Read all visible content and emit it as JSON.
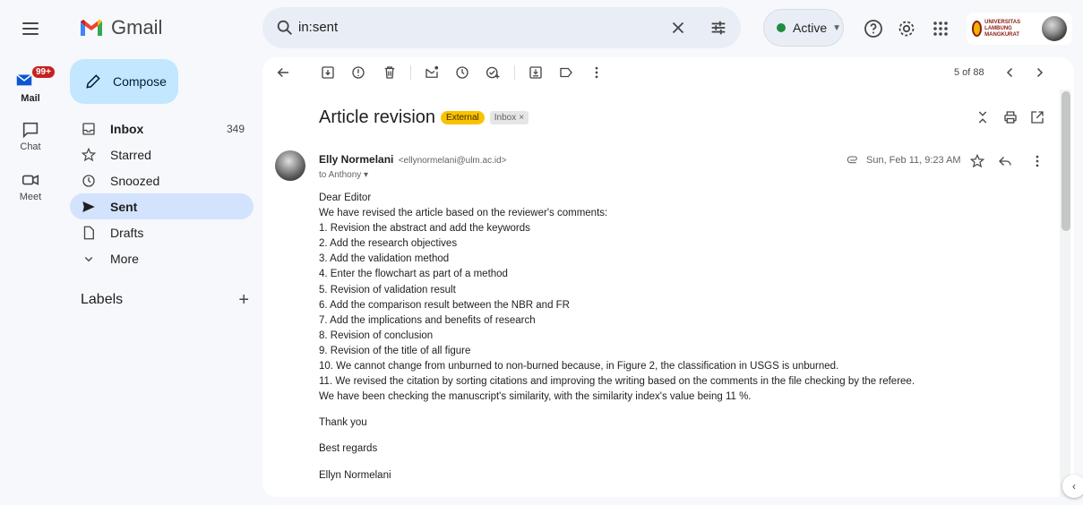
{
  "app": {
    "name": "Gmail"
  },
  "search": {
    "query": "in:sent"
  },
  "status": {
    "label": "Active",
    "color": "#1e8e3e"
  },
  "account": {
    "institution": "UNIVERSITAS LAMBUNG MANGKURAT"
  },
  "rail": {
    "mail": {
      "label": "Mail",
      "badge": "99+"
    },
    "chat": {
      "label": "Chat"
    },
    "meet": {
      "label": "Meet"
    }
  },
  "compose": {
    "label": "Compose"
  },
  "nav": {
    "items": [
      {
        "label": "Inbox",
        "count": "349",
        "icon": "inbox-icon"
      },
      {
        "label": "Starred",
        "icon": "star-icon"
      },
      {
        "label": "Snoozed",
        "icon": "clock-icon"
      },
      {
        "label": "Sent",
        "icon": "send-icon"
      },
      {
        "label": "Drafts",
        "icon": "draft-icon"
      },
      {
        "label": "More",
        "icon": "chevron-down-icon"
      }
    ],
    "labels_title": "Labels"
  },
  "toolbar": {
    "pager": "5 of 88"
  },
  "message": {
    "subject": "Article revision",
    "tags": {
      "external": "External",
      "inbox": "Inbox",
      "remove": "×"
    },
    "sender_name": "Elly Normelani",
    "sender_email": "<ellynormelani@ulm.ac.id>",
    "to": "to Anthony ▾",
    "date": "Sun, Feb 11, 9:23 AM",
    "body_lines": [
      "Dear Editor",
      "We have revised the article based on the reviewer's comments:",
      "1. Revision the abstract and add the keywords",
      "2. Add the research objectives",
      "3. Add the validation method",
      "4. Enter the flowchart as part of a method",
      "5. Revision of validation result",
      "6. Add the comparison result between the NBR and FR",
      "7. Add the implications and benefits of research",
      "8. Revision of conclusion",
      "9. Revision of the title of all figure",
      "10. We cannot change from unburned to non-burned because, in Figure 2, the classification in USGS is unburned.",
      "11. We revised the citation by sorting citations and improving the writing based on the comments in the file checking by the referee.",
      "We have been checking the manuscript's similarity, with the similarity index's value being 11 %."
    ],
    "thanks": "Thank you",
    "regards": "Best regards",
    "signature": "Ellyn Normelani"
  },
  "colors": {
    "background": "#f6f8fc",
    "compose": "#c2e7ff",
    "active_nav": "#d3e3fd",
    "external_tag": "#f9c200",
    "badge": "#c5221f"
  }
}
